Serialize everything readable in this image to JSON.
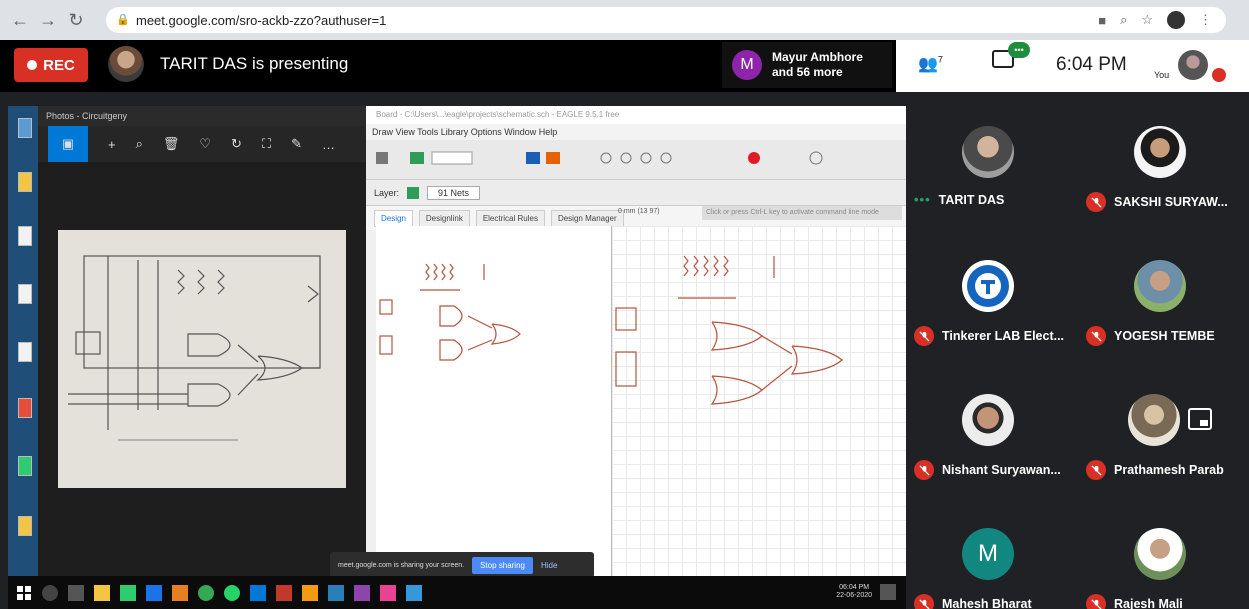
{
  "browser": {
    "url": "meet.google.com/sro-ackb-zzo?authuser=1"
  },
  "meet": {
    "rec_label": "REC",
    "presenting_text": "TARIT DAS is presenting",
    "others_initial": "M",
    "others_line1": "Mayur Ambhore",
    "others_line2": "and 56 more",
    "people_count": "7",
    "people_label": "",
    "chat_badge": "•••",
    "time": "6:04 PM",
    "you_label": "You"
  },
  "share": {
    "photos_title": "Photos - Circuitgeny",
    "eagle_title": "Board - C:\\Users\\...\\eagle\\projects\\schematic.sch - EAGLE 9.5.1 free",
    "eagle_menu": "Draw  View  Tools  Library  Options  Window  Help",
    "layer_label": "Layer:",
    "layer_value": "91 Nets",
    "tabs": [
      "Design",
      "Designlink",
      "Electrical Rules",
      "Design Manager"
    ],
    "coord": "0 mm (13 97)",
    "cmd_placeholder": "Click or press Ctrl-L key to activate command line mode",
    "sharebar_msg": "meet.google.com is sharing your screen.",
    "stop_label": "Stop sharing",
    "hide_label": "Hide",
    "taskbar_time": "06:04 PM",
    "taskbar_date": "22-06-2020"
  },
  "participants": [
    {
      "name": "TARIT DAS",
      "muted": false,
      "speaking": true
    },
    {
      "name": "SAKSHI SURYAW...",
      "muted": true
    },
    {
      "name": "Tinkerer LAB Elect...",
      "muted": true
    },
    {
      "name": "YOGESH TEMBE",
      "muted": true
    },
    {
      "name": "Nishant Suryawan...",
      "muted": true
    },
    {
      "name": "Prathamesh Parab",
      "muted": true
    },
    {
      "name": "Mahesh Bharat",
      "muted": true,
      "initial": "M"
    },
    {
      "name": "Rajesh Mali",
      "muted": true
    }
  ],
  "colors": {
    "rec": "#d93025",
    "meet_bg": "#202124",
    "mute_red": "#d93025",
    "speaking_green": "#1ea362",
    "avatar_teal": "#12877f"
  }
}
